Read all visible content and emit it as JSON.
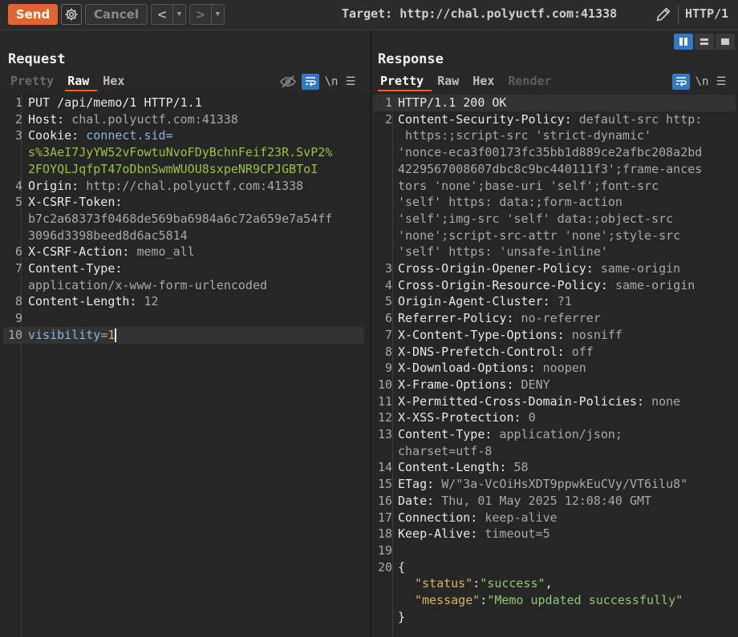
{
  "toolbar": {
    "send_label": "Send",
    "cancel_label": "Cancel",
    "back_icon": "chevron-left",
    "forward_icon": "chevron-right",
    "target_label": "Target: http://chal.polyuctf.com:41338",
    "protocol_label": "HTTP/1"
  },
  "colors": {
    "accent": "#e0652f",
    "toggle_blue": "#2f79c6",
    "header_value_green": "#9cc23f"
  },
  "request": {
    "title": "Request",
    "tabs": [
      "Pretty",
      "Raw",
      "Hex"
    ],
    "active_tab": "Raw",
    "newline_label": "\\n",
    "lines": {
      "l1": "PUT /api/memo/1 HTTP/1.1",
      "l2k": "Host:",
      "l2v": "chal.polyuctf.com:41338",
      "l3k": "Cookie:",
      "l3n": "connect.sid=",
      "l3v1": "s%3AeI7JyYW52vFowtuNvoFDyBchnFeif23R.SvP2%",
      "l3v2": "2FOYQLJqfpT47oDbnSwmWUOU8sxpeNR9CPJGBToI",
      "l4k": "Origin:",
      "l4v": "http://chal.polyuctf.com:41338",
      "l5k": "X-CSRF-Token:",
      "l5v1": "b7c2a68373f0468de569ba6984a6c72a659e7a54ff",
      "l5v2": "3096d3398beed8d6ac5814",
      "l6k": "X-CSRF-Action:",
      "l6v": "memo_all",
      "l7k": "Content-Type:",
      "l7v": "application/x-www-form-urlencoded",
      "l8k": "Content-Length:",
      "l8v": "12",
      "l10k": "visibility",
      "l10eq": "=",
      "l10v": "1"
    }
  },
  "response": {
    "title": "Response",
    "tabs": [
      "Pretty",
      "Raw",
      "Hex",
      "Render"
    ],
    "active_tab": "Pretty",
    "newline_label": "\\n",
    "lines": {
      "l1": "HTTP/1.1 200 OK",
      "l2k": "Content-Security-Policy:",
      "l2a": "default-src http:",
      "l2b": "https:;script-src 'strict-dynamic'",
      "l2c": "'nonce-eca3f00173fc35bb1d889ce2afbc208a2bd",
      "l2d": "4229567008607dbc8c9bc440111f3';frame-ances",
      "l2e": "tors 'none';base-uri 'self';font-src",
      "l2f": "'self' https: data:;form-action",
      "l2g": "'self';img-src 'self' data:;object-src",
      "l2h": "'none';script-src-attr 'none';style-src",
      "l2i": "'self' https: 'unsafe-inline'",
      "l3k": "Cross-Origin-Opener-Policy:",
      "l3v": "same-origin",
      "l4k": "Cross-Origin-Resource-Policy:",
      "l4v": "same-origin",
      "l5k": "Origin-Agent-Cluster:",
      "l5v": "?1",
      "l6k": "Referrer-Policy:",
      "l6v": "no-referrer",
      "l7k": "X-Content-Type-Options:",
      "l7v": "nosniff",
      "l8k": "X-DNS-Prefetch-Control:",
      "l8v": "off",
      "l9k": "X-Download-Options:",
      "l9v": "noopen",
      "l10k": "X-Frame-Options:",
      "l10v": "DENY",
      "l11k": "X-Permitted-Cross-Domain-Policies:",
      "l11v": "none",
      "l12k": "X-XSS-Protection:",
      "l12v": "0",
      "l13k": "Content-Type:",
      "l13v": "application/json;",
      "l13v2": "charset=utf-8",
      "l14k": "Content-Length:",
      "l14v": "58",
      "l15k": "ETag:",
      "l15v": "W/\"3a-VcOiHsXDT9ppwkEuCVy/VT6ilu8\"",
      "l16k": "Date:",
      "l16v": "Thu, 01 May 2025 12:08:40 GMT",
      "l17k": "Connection:",
      "l17v": "keep-alive",
      "l18k": "Keep-Alive:",
      "l18v": "timeout=5",
      "l20": "{",
      "j1k": "\"status\"",
      "j1c": ":",
      "j1v": "\"success\"",
      "j1e": ",",
      "j2k": "\"message\"",
      "j2c": ":",
      "j2v": "\"Memo updated successfully\"",
      "jclose": "}"
    }
  }
}
